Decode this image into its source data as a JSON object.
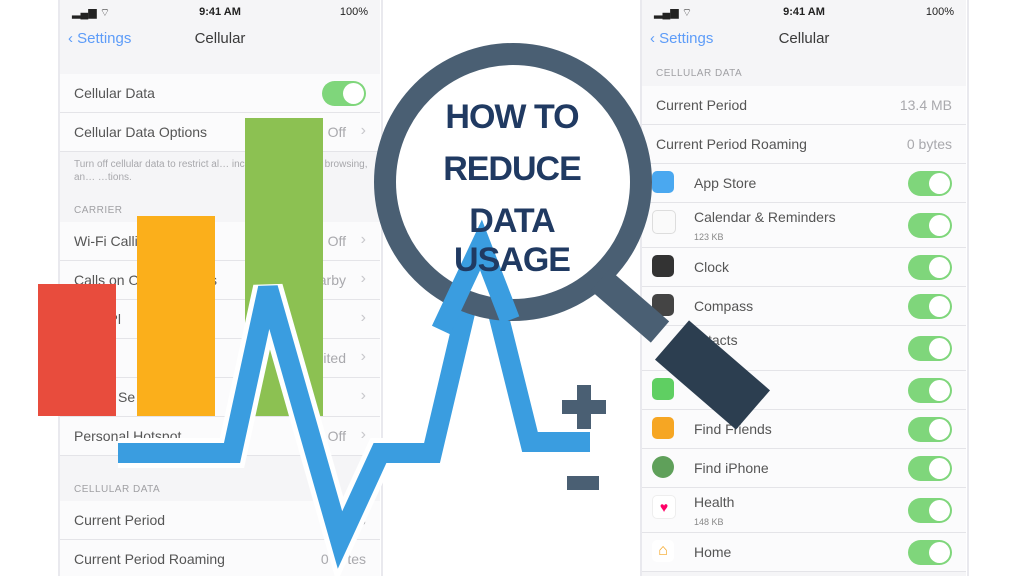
{
  "status": {
    "time": "9:41 AM",
    "battery": "100%",
    "signal": "▂▄▆ ⌔"
  },
  "left_phone": {
    "back": "Settings",
    "title": "Cellular",
    "cellular_data": "Cellular Data",
    "cellular_data_options": "Cellular Data Options",
    "options_value": "Off",
    "footnote": "Turn off cellular data to restrict al… including email, web browsing, an… …tions.",
    "carrier_header": "CARRIER",
    "wifi_calling": "Wi-Fi Calli",
    "wifi_calling_value": "Off",
    "calls_other": "Calls on O",
    "calls_other_suffix": "s",
    "calls_other_value": "W…arby",
    "row3_label": "r Pl",
    "row4_value": "30.7 … Unlimited",
    "row5_label": "Se",
    "personal_hotspot": "Personal Hotspot",
    "hotspot_value": "Off",
    "cellular_data_header": "CELLULAR DATA",
    "current_period": "Current Period",
    "current_period_value": "…B",
    "roaming": "Current Period Roaming",
    "roaming_value": "0 bytes"
  },
  "right_phone": {
    "back": "Settings",
    "title": "Cellular",
    "section_header": "CELLULAR DATA",
    "current_period": "Current Period",
    "current_period_value": "13.4 MB",
    "roaming": "Current Period Roaming",
    "roaming_value": "0 bytes",
    "apps": [
      {
        "name": "App Store",
        "sub": ""
      },
      {
        "name": "Calendar & Reminders",
        "sub": "123 KB"
      },
      {
        "name": "Clock",
        "sub": ""
      },
      {
        "name": "Compass",
        "sub": ""
      },
      {
        "name": "…tacts",
        "sub": ""
      },
      {
        "name": "",
        "sub": ""
      },
      {
        "name": "Find Friends",
        "sub": ""
      },
      {
        "name": "Find iPhone",
        "sub": ""
      },
      {
        "name": "Health",
        "sub": "148 KB"
      },
      {
        "name": "Home",
        "sub": ""
      }
    ]
  },
  "overlay": {
    "line1": "HOW TO",
    "line2": "REDUCE",
    "line3": "DATA USAGE"
  },
  "colors": {
    "bar_red": "#e84c3d",
    "bar_orange": "#fbaf1b",
    "bar_green": "#8cc152",
    "pulse_blue": "#3a9de0",
    "lens_ring": "#4a5f73",
    "handle": "#2c3e50",
    "text_navy": "#203a62"
  }
}
